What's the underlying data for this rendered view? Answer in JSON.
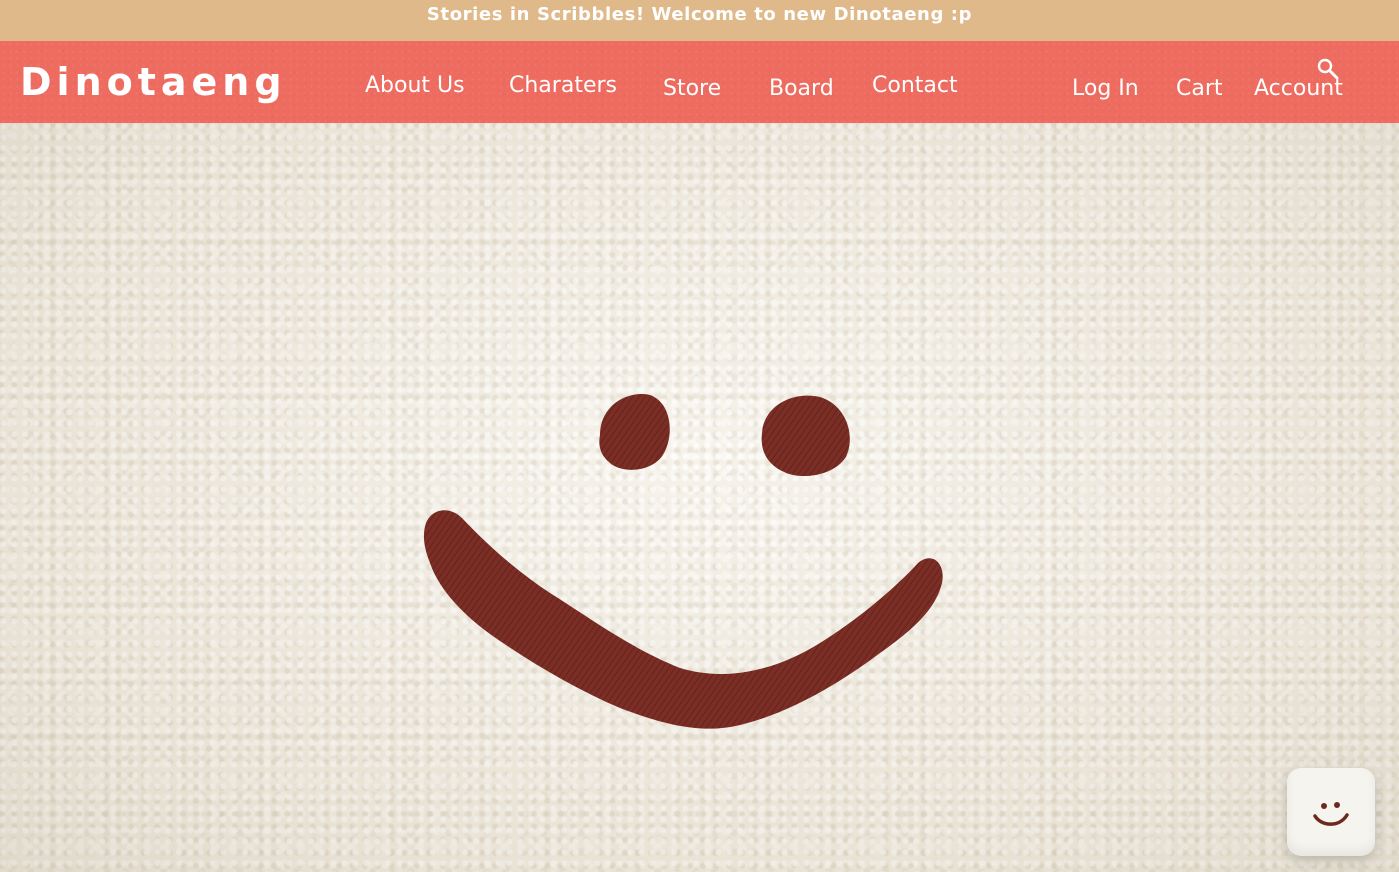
{
  "announcement": {
    "text": "Stories in Scribbles! Welcome to new Dinotaeng :p"
  },
  "header": {
    "logo": "Dinotaeng",
    "nav": {
      "about_us": "About Us",
      "characters": "Charaters",
      "store": "Store",
      "board": "Board",
      "contact": "Contact"
    },
    "utility": {
      "log_in": "Log In",
      "cart": "Cart",
      "account": "Account",
      "search_icon": "search-icon"
    }
  },
  "hero": {
    "image": "embroidered-smiley-face-on-fleece"
  },
  "chat_widget": {
    "icon": "smiley-face-icon"
  },
  "colors": {
    "announcement_bg": "#dfb98a",
    "header_bg": "#ee6b60",
    "text_light": "#ffffff",
    "fleece": "#f3eee3",
    "embroidery": "#7a2e25"
  }
}
